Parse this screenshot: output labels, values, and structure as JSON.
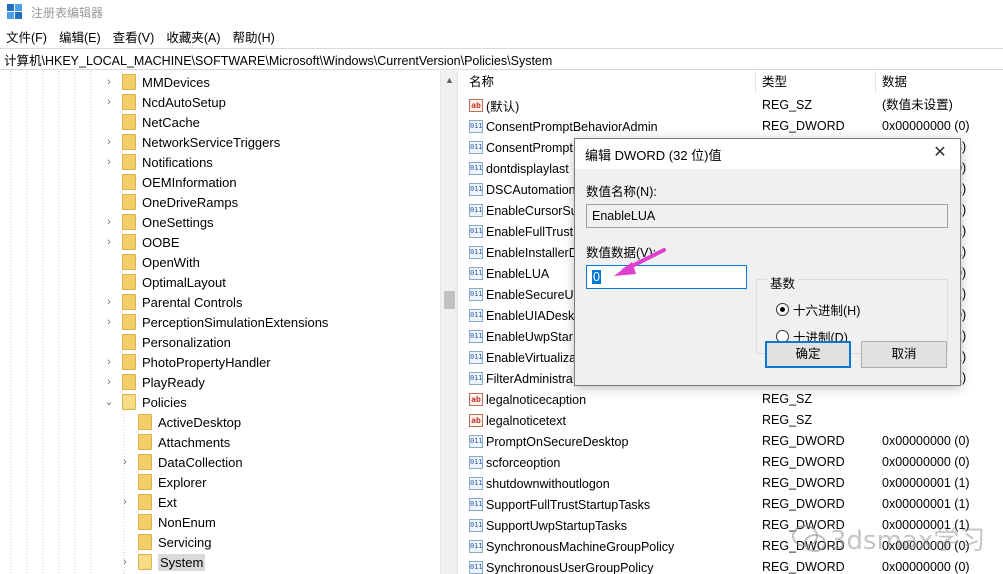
{
  "window": {
    "title": "注册表编辑器"
  },
  "menu": [
    "文件(F)",
    "编辑(E)",
    "查看(V)",
    "收藏夹(A)",
    "帮助(H)"
  ],
  "address": "计算机\\HKEY_LOCAL_MACHINE\\SOFTWARE\\Microsoft\\Windows\\CurrentVersion\\Policies\\System",
  "tree": [
    {
      "label": "MMDevices",
      "level": 0,
      "expander": ">"
    },
    {
      "label": "NcdAutoSetup",
      "level": 0,
      "expander": ">"
    },
    {
      "label": "NetCache",
      "level": 0,
      "expander": ""
    },
    {
      "label": "NetworkServiceTriggers",
      "level": 0,
      "expander": ">"
    },
    {
      "label": "Notifications",
      "level": 0,
      "expander": ">"
    },
    {
      "label": "OEMInformation",
      "level": 0,
      "expander": ""
    },
    {
      "label": "OneDriveRamps",
      "level": 0,
      "expander": ""
    },
    {
      "label": "OneSettings",
      "level": 0,
      "expander": ">"
    },
    {
      "label": "OOBE",
      "level": 0,
      "expander": ">"
    },
    {
      "label": "OpenWith",
      "level": 0,
      "expander": ""
    },
    {
      "label": "OptimalLayout",
      "level": 0,
      "expander": ""
    },
    {
      "label": "Parental Controls",
      "level": 0,
      "expander": ">"
    },
    {
      "label": "PerceptionSimulationExtensions",
      "level": 0,
      "expander": ">"
    },
    {
      "label": "Personalization",
      "level": 0,
      "expander": ""
    },
    {
      "label": "PhotoPropertyHandler",
      "level": 0,
      "expander": ">"
    },
    {
      "label": "PlayReady",
      "level": 0,
      "expander": ">"
    },
    {
      "label": "Policies",
      "level": 0,
      "expander": "v"
    },
    {
      "label": "ActiveDesktop",
      "level": 1,
      "expander": ""
    },
    {
      "label": "Attachments",
      "level": 1,
      "expander": ""
    },
    {
      "label": "DataCollection",
      "level": 1,
      "expander": ">"
    },
    {
      "label": "Explorer",
      "level": 1,
      "expander": ""
    },
    {
      "label": "Ext",
      "level": 1,
      "expander": ">"
    },
    {
      "label": "NonEnum",
      "level": 1,
      "expander": ""
    },
    {
      "label": "Servicing",
      "level": 1,
      "expander": ""
    },
    {
      "label": "System",
      "level": 1,
      "expander": ">",
      "selected": true
    }
  ],
  "list": {
    "headers": {
      "name": "名称",
      "type": "类型",
      "data": "数据"
    },
    "rows": [
      {
        "icon": "ab",
        "name": "(默认)",
        "type": "REG_SZ",
        "data": "(数值未设置)"
      },
      {
        "icon": "dw",
        "name": "ConsentPromptBehaviorAdmin",
        "type": "REG_DWORD",
        "data": "0x00000000 (0)"
      },
      {
        "icon": "dw",
        "name": "ConsentPrompt",
        "type": "",
        "data": "3)"
      },
      {
        "icon": "dw",
        "name": "dontdisplaylast",
        "type": "",
        "data": "0)"
      },
      {
        "icon": "dw",
        "name": "DSCAutomation",
        "type": "",
        "data": "2)"
      },
      {
        "icon": "dw",
        "name": "EnableCursorSu",
        "type": "",
        "data": "1)"
      },
      {
        "icon": "dw",
        "name": "EnableFullTrust",
        "type": "",
        "data": "2)"
      },
      {
        "icon": "dw",
        "name": "EnableInstallerD",
        "type": "",
        "data": "1)"
      },
      {
        "icon": "dw",
        "name": "EnableLUA",
        "type": "",
        "data": "0)"
      },
      {
        "icon": "dw",
        "name": "EnableSecureUI",
        "type": "",
        "data": "1)"
      },
      {
        "icon": "dw",
        "name": "EnableUIADesk",
        "type": "",
        "data": "0)"
      },
      {
        "icon": "dw",
        "name": "EnableUwpStar",
        "type": "",
        "data": "2)"
      },
      {
        "icon": "dw",
        "name": "EnableVirtualiza",
        "type": "",
        "data": "1)"
      },
      {
        "icon": "dw",
        "name": "FilterAdministra",
        "type": "",
        "data": "1)"
      },
      {
        "icon": "ab",
        "name": "legalnoticecaption",
        "type": "REG_SZ",
        "data": ""
      },
      {
        "icon": "ab",
        "name": "legalnoticetext",
        "type": "REG_SZ",
        "data": ""
      },
      {
        "icon": "dw",
        "name": "PromptOnSecureDesktop",
        "type": "REG_DWORD",
        "data": "0x00000000 (0)"
      },
      {
        "icon": "dw",
        "name": "scforceoption",
        "type": "REG_DWORD",
        "data": "0x00000000 (0)"
      },
      {
        "icon": "dw",
        "name": "shutdownwithoutlogon",
        "type": "REG_DWORD",
        "data": "0x00000001 (1)"
      },
      {
        "icon": "dw",
        "name": "SupportFullTrustStartupTasks",
        "type": "REG_DWORD",
        "data": "0x00000001 (1)"
      },
      {
        "icon": "dw",
        "name": "SupportUwpStartupTasks",
        "type": "REG_DWORD",
        "data": "0x00000001 (1)"
      },
      {
        "icon": "dw",
        "name": "SynchronousMachineGroupPolicy",
        "type": "REG_DWORD",
        "data": "0x00000000 (0)"
      },
      {
        "icon": "dw",
        "name": "SynchronousUserGroupPolicy",
        "type": "REG_DWORD",
        "data": "0x00000000 (0)"
      }
    ]
  },
  "dialog": {
    "title": "编辑 DWORD (32 位)值",
    "close": "✕",
    "value_name_label": "数值名称(N):",
    "value_name": "EnableLUA",
    "value_data_label": "数值数据(V):",
    "value_data": "0",
    "base_label": "基数",
    "hex_label": "十六进制(H)",
    "dec_label": "十进制(D)",
    "base_selected": "hex",
    "ok": "确定",
    "cancel": "取消"
  },
  "watermark": "3dsmax学习",
  "icons": {
    "string_value": "string-value-icon",
    "dword_value": "dword-value-icon",
    "folder": "folder-icon",
    "pointer": "annotation-arrow-icon"
  },
  "colors": {
    "selection": "#0078d7",
    "folder": "#f3cf6a",
    "annotation": "#e040d0"
  }
}
